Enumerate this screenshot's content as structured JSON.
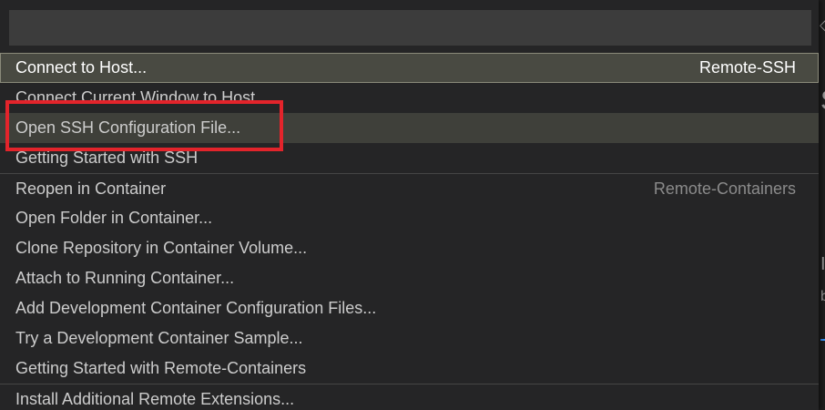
{
  "palette": {
    "input": {
      "value": "",
      "placeholder": ""
    },
    "items": [
      {
        "label": "Connect to Host...",
        "group": "Remote-SSH",
        "state": "selected"
      },
      {
        "label": "Connect Current Window to Host...",
        "group": "",
        "state": ""
      },
      {
        "label": "Open SSH Configuration File...",
        "group": "",
        "state": "hover"
      },
      {
        "label": "Getting Started with SSH",
        "group": "",
        "state": ""
      },
      {
        "label": "Reopen in Container",
        "group": "Remote-Containers",
        "state": ""
      },
      {
        "label": "Open Folder in Container...",
        "group": "",
        "state": ""
      },
      {
        "label": "Clone Repository in Container Volume...",
        "group": "",
        "state": ""
      },
      {
        "label": "Attach to Running Container...",
        "group": "",
        "state": ""
      },
      {
        "label": "Add Development Container Configuration Files...",
        "group": "",
        "state": ""
      },
      {
        "label": "Try a Development Container Sample...",
        "group": "",
        "state": ""
      },
      {
        "label": "Getting Started with Remote-Containers",
        "group": "",
        "state": ""
      },
      {
        "label": "Install Additional Remote Extensions...",
        "group": "",
        "state": ""
      }
    ]
  },
  "colors": {
    "highlight_box": "#e3242b",
    "selected_background": "#494a42",
    "palette_background": "#252526"
  }
}
